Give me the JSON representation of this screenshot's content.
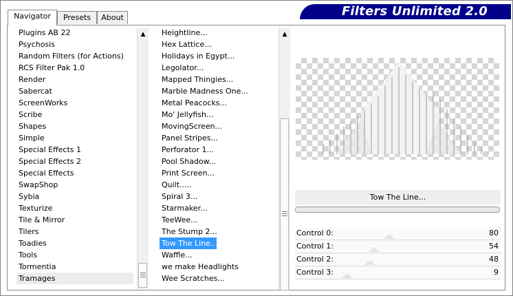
{
  "tabs": [
    "Navigator",
    "Presets",
    "About"
  ],
  "banner_title": "Filters Unlimited 2.0",
  "categories": [
    "Plugins AB 22",
    "Psychosis",
    "Random Filters (for Actions)",
    "RCS Filter Pak 1.0",
    "Render",
    "Sabercat",
    "ScreenWorks",
    "Scribe",
    "Shapes",
    "Simple",
    "Special Effects 1",
    "Special Effects 2",
    "Special Effects",
    "SwapShop",
    "Sybia",
    "Texturize",
    "Tile & Mirror",
    "Tilers",
    "Toadies",
    "Tools",
    "Tormentia",
    "Tramages"
  ],
  "selected_category": "Tramages",
  "filters": [
    "Heightline...",
    "Hex Lattice...",
    "Holidays in Egypt...",
    "Legolator...",
    "Mapped Thingies...",
    "Marble Madness One...",
    "Metal Peacocks...",
    "Mo' Jellyfish...",
    "MovingScreen...",
    "Panel Stripes...",
    "Perforator 1...",
    "Pool Shadow...",
    "Print Screen...",
    "Quilt.....",
    "Spiral 3...",
    "Starmaker...",
    "TeeWee...",
    "The Stump 2...",
    "Tow The Line...",
    "Waffle...",
    "we make Headlights",
    "Wee Scratches..."
  ],
  "selected_filter": "Tow The Line...",
  "filter_name": "Tow The Line...",
  "controls": [
    {
      "label": "Control 0:",
      "value": "80",
      "level": 80
    },
    {
      "label": "Control 1:",
      "value": "54",
      "level": 54
    },
    {
      "label": "Control 2:",
      "value": "48",
      "level": 48
    },
    {
      "label": "Control 3:",
      "value": "9",
      "level": 9
    }
  ],
  "icons": {
    "scroll_up": "up-arrow-icon",
    "scroll_grip": "grip-icon"
  }
}
